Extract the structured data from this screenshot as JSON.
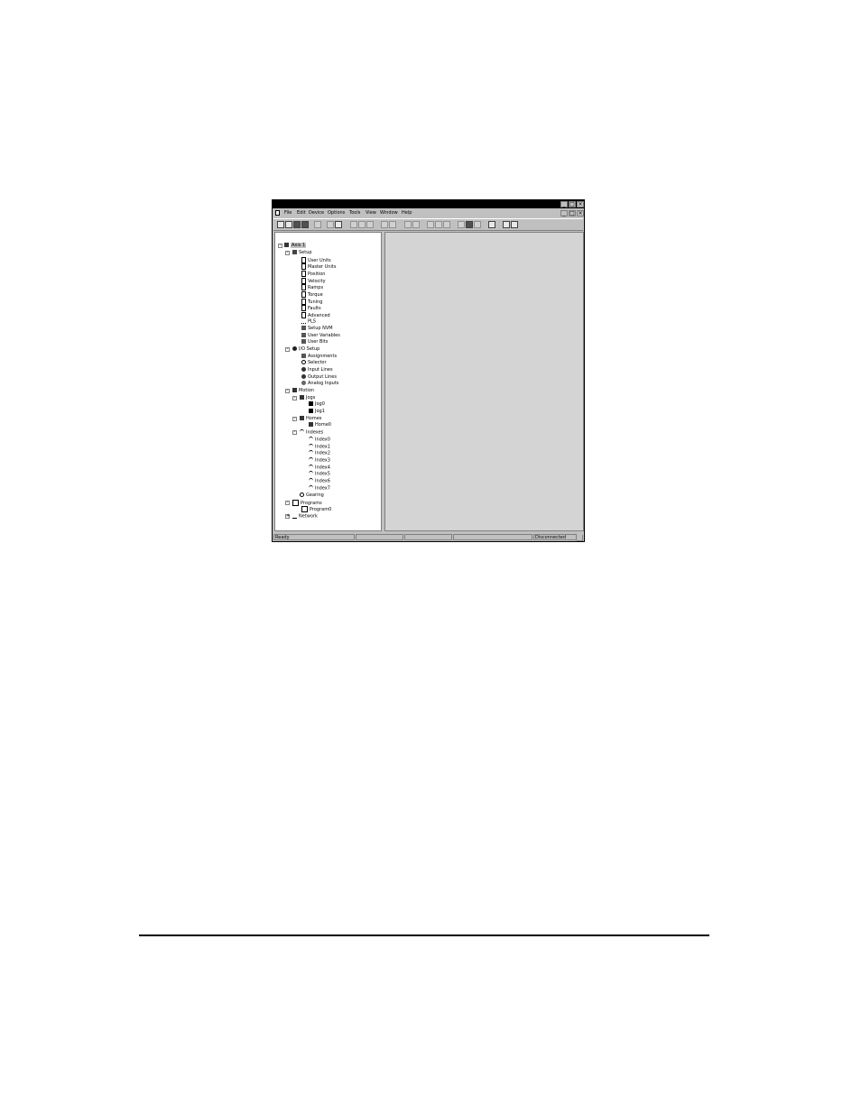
{
  "window": {
    "menu": [
      "File",
      "Edit",
      "Device",
      "Options",
      "Tools",
      "View",
      "Window",
      "Help"
    ]
  },
  "tree": {
    "root": "Axis 1",
    "setup": "Setup",
    "setup_items": [
      "User Units",
      "Master Units",
      "Position",
      "Velocity",
      "Ramps",
      "Torque",
      "Tuning",
      "Faults",
      "Advanced"
    ],
    "pls": "PLS",
    "setup_nvm": "Setup NVM",
    "user_variables": "User Variables",
    "user_bits": "User Bits",
    "io_setup": "I/O Setup",
    "io_items": [
      "Assignments",
      "Selector",
      "Input Lines",
      "Output Lines",
      "Analog Inputs"
    ],
    "motion": "Motion",
    "jogs": "Jogs",
    "jog_items": [
      "Jog0",
      "Jog1"
    ],
    "homes": "Homes",
    "home_items": [
      "Home0"
    ],
    "indexes": "Indexes",
    "index_items": [
      "Index0",
      "Index1",
      "Index2",
      "Index3",
      "Index4",
      "Index5",
      "Index6",
      "Index7"
    ],
    "gearing": "Gearing",
    "programs": "Programs",
    "program_items": [
      "Program0"
    ],
    "network": "Network"
  },
  "status": {
    "left": "Ready",
    "right": "Disconnected"
  }
}
